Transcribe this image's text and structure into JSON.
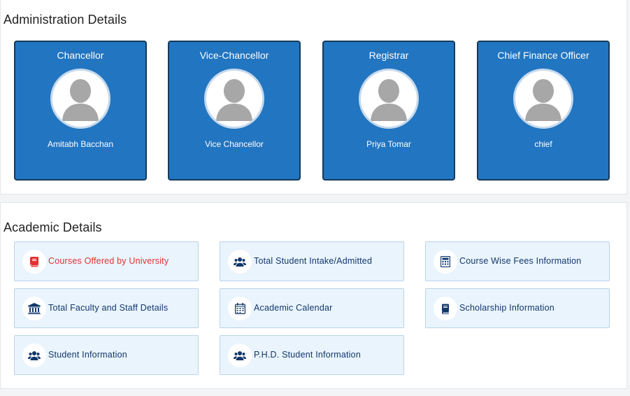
{
  "administration": {
    "title": "Administration Details",
    "cards": [
      {
        "role": "Chancellor",
        "name": "Amitabh Bacchan"
      },
      {
        "role": "Vice-Chancellor",
        "name": "Vice Chancellor"
      },
      {
        "role": "Registrar",
        "name": "Priya Tomar"
      },
      {
        "role": "Chief Finance Officer",
        "name": "chief"
      }
    ]
  },
  "academic": {
    "title": "Academic Details",
    "items": [
      {
        "label": "Courses Offered by University",
        "icon": "book-icon",
        "active": true
      },
      {
        "label": "Total Student Intake/Admitted",
        "icon": "users-icon"
      },
      {
        "label": "Course Wise Fees Information",
        "icon": "calculator-icon"
      },
      {
        "label": "Total Faculty and Staff Details",
        "icon": "bank-icon"
      },
      {
        "label": "Academic Calendar",
        "icon": "calendar-icon"
      },
      {
        "label": "Scholarship Information",
        "icon": "book-icon"
      },
      {
        "label": "Student Information",
        "icon": "users-icon"
      },
      {
        "label": "P.H.D. Student Information",
        "icon": "users-icon"
      }
    ]
  },
  "colors": {
    "card_bg": "#2275c0",
    "tile_bg": "#eaf4fd",
    "tile_text": "#12376b",
    "active_text": "#e03232"
  }
}
